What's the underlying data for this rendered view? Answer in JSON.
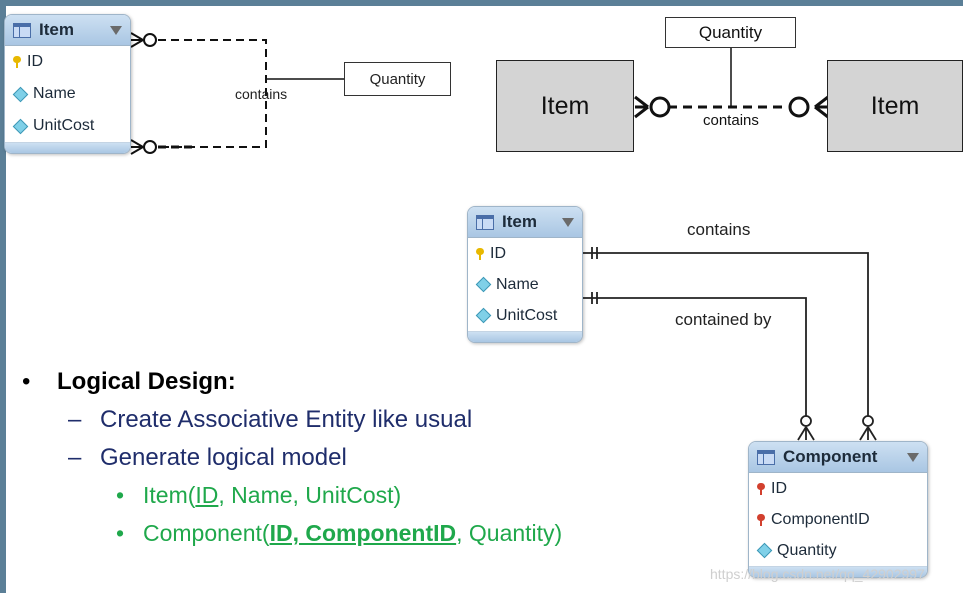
{
  "top_left": {
    "table": {
      "title": "Item",
      "fields": [
        {
          "name": "ID",
          "kind": "pk"
        },
        {
          "name": "Name",
          "kind": "attr"
        },
        {
          "name": "UnitCost",
          "kind": "attr"
        }
      ]
    },
    "rel_label": "contains",
    "assoc_box": "Quantity"
  },
  "top_right": {
    "left_entity": "Item",
    "right_entity": "Item",
    "rel_label": "contains",
    "assoc_box": "Quantity"
  },
  "middle": {
    "item_table": {
      "title": "Item",
      "fields": [
        {
          "name": "ID",
          "kind": "pk"
        },
        {
          "name": "Name",
          "kind": "attr"
        },
        {
          "name": "UnitCost",
          "kind": "attr"
        }
      ]
    },
    "component_table": {
      "title": "Component",
      "fields": [
        {
          "name": "ID",
          "kind": "fk"
        },
        {
          "name": "ComponentID",
          "kind": "fk"
        },
        {
          "name": "Quantity",
          "kind": "attr"
        }
      ]
    },
    "rel_contains": "contains",
    "rel_contained_by": "contained by"
  },
  "bullets": {
    "bullet_glyph": "•",
    "dash_glyph": "–",
    "heading": "Logical Design:",
    "sub1": "Create Associative Entity like usual",
    "sub2": "Generate logical model",
    "item_line": {
      "prefix": "Item(",
      "key": "ID",
      "rest": ", Name, UnitCost)"
    },
    "component_line": {
      "prefix": "Component(",
      "key": "ID, ComponentID",
      "rest": ", Quantity)"
    }
  },
  "watermark": "https://blog.csdn.net/qq_42902997",
  "colors": {
    "header_blue": "#a9c6e3",
    "pk_key": "#e8b800",
    "fk_key": "#d2402e",
    "attr_diamond": "#7fd0e8",
    "heading_navy": "#1f2d6b",
    "logical_green": "#1fa84b",
    "entity_gray": "#d4d4d4"
  }
}
